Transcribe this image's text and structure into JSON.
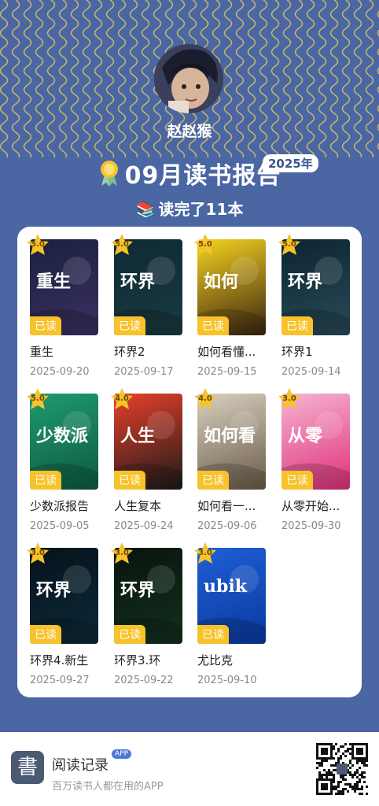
{
  "user": {
    "name": "赵赵猴"
  },
  "header": {
    "title": "09月读书报告",
    "year_badge": "2025年",
    "read_count": "读完了11本"
  },
  "books": [
    {
      "title": "重生",
      "date": "2025-09-20",
      "rating": "5.0",
      "tag": "已读",
      "cover_text": "重生",
      "colors": [
        "#1a2040",
        "#3b3060"
      ]
    },
    {
      "title": "环界2",
      "date": "2025-09-17",
      "rating": "5.0",
      "tag": "已读",
      "cover_text": "环界",
      "colors": [
        "#0f2a35",
        "#1a3a40"
      ]
    },
    {
      "title": "如何看懂...",
      "date": "2025-09-15",
      "rating": "5.0",
      "tag": "已读",
      "cover_text": "如何",
      "colors": [
        "#f5d320",
        "#3a2410"
      ]
    },
    {
      "title": "环界1",
      "date": "2025-09-14",
      "rating": "5.0",
      "tag": "已读",
      "cover_text": "环界",
      "colors": [
        "#0b2530",
        "#2a4a58"
      ]
    },
    {
      "title": "少数派报告",
      "date": "2025-09-05",
      "rating": "5.0",
      "tag": "已读",
      "cover_text": "少数派",
      "colors": [
        "#1f9a6e",
        "#0e5a40"
      ]
    },
    {
      "title": "人生复本",
      "date": "2025-09-24",
      "rating": "4.0",
      "tag": "已读",
      "cover_text": "人生",
      "colors": [
        "#e8402a",
        "#1a1a1a"
      ]
    },
    {
      "title": "如何看一...",
      "date": "2025-09-06",
      "rating": "4.0",
      "tag": "已读",
      "cover_text": "如何看",
      "colors": [
        "#d8d0c0",
        "#6a5a48"
      ]
    },
    {
      "title": "从零开始...",
      "date": "2025-09-30",
      "rating": "3.0",
      "tag": "已读",
      "cover_text": "从零",
      "colors": [
        "#f5b4d0",
        "#e0307a"
      ]
    },
    {
      "title": "环界4.新生",
      "date": "2025-09-27",
      "rating": "3.0",
      "tag": "已读",
      "cover_text": "环界",
      "colors": [
        "#06121a",
        "#0c2a3a"
      ]
    },
    {
      "title": "环界3.环",
      "date": "2025-09-22",
      "rating": "3.0",
      "tag": "已读",
      "cover_text": "环界",
      "colors": [
        "#08140c",
        "#13301e"
      ]
    },
    {
      "title": "尤比克",
      "date": "2025-09-10",
      "rating": "3.0",
      "tag": "已读",
      "cover_text": "ubik",
      "colors": [
        "#1f5fd4",
        "#0a3aa0"
      ]
    }
  ],
  "footer": {
    "app_name": "阅读记录",
    "app_badge": "APP",
    "slogan": "百万读书人都在用的APP",
    "logo_char": "書"
  }
}
